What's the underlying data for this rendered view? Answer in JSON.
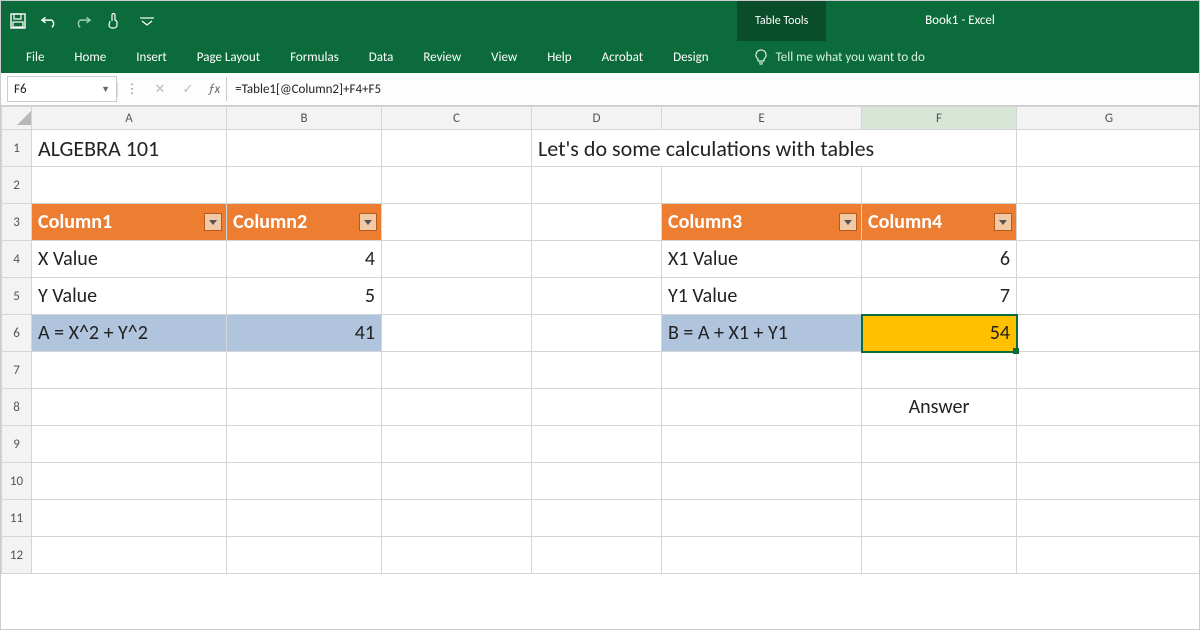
{
  "titlebar": {
    "table_tools": "Table Tools",
    "doc_title": "Book1  -  Excel"
  },
  "ribbon": {
    "tabs": [
      "File",
      "Home",
      "Insert",
      "Page Layout",
      "Formulas",
      "Data",
      "Review",
      "View",
      "Help",
      "Acrobat",
      "Design"
    ],
    "tell_me": "Tell me what you want to do"
  },
  "formula_bar": {
    "name_box": "F6",
    "formula": "=Table1[@Column2]+F4+F5"
  },
  "columns": [
    "A",
    "B",
    "C",
    "D",
    "E",
    "F",
    "G"
  ],
  "rows": [
    "1",
    "2",
    "3",
    "4",
    "5",
    "6",
    "7",
    "8",
    "9",
    "10",
    "11",
    "12"
  ],
  "cells": {
    "A1": "ALGEBRA 101",
    "D1": "Let's do some calculations with tables",
    "A3": "Column1",
    "B3": "Column2",
    "E3": "Column3",
    "F3": "Column4",
    "A4": "X Value",
    "B4": "4",
    "E4": "X1 Value",
    "F4": "6",
    "A5": "Y Value",
    "B5": "5",
    "E5": "Y1 Value",
    "F5": "7",
    "A6": "A = X^2 + Y^2",
    "B6": "41",
    "E6": "B = A + X1 + Y1",
    "F6": "54",
    "F8": "Answer"
  },
  "selected_cell": "F6"
}
